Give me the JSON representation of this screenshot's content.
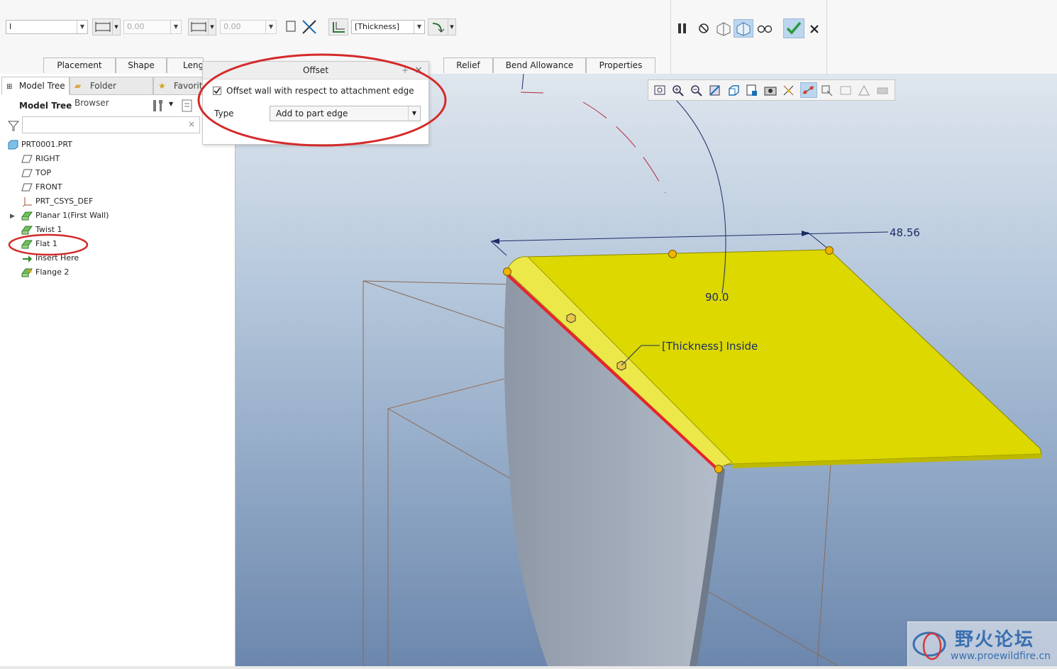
{
  "dashboard": {
    "type_value": "I",
    "length_value_1": "0.00",
    "length_value_2": "0.00",
    "thickness_value": "[Thickness]",
    "tabs": [
      "Placement",
      "Shape",
      "Leng",
      "Relief",
      "Bend Allowance",
      "Properties"
    ],
    "colors": {
      "ok_check": "#2a9a3a",
      "active_toggle": "#bcd6ee"
    }
  },
  "offset_panel": {
    "title": "Offset",
    "checkbox_label": "Offset wall with respect to attachment edge",
    "checkbox_checked": true,
    "type_label": "Type",
    "type_value": "Add to part edge",
    "close_glyph": "×",
    "pin_glyph": "+"
  },
  "navigator": {
    "tabs": [
      "Model Tree",
      "Folder Browser",
      "Favorit"
    ],
    "header": "Model Tree",
    "search_placeholder": "",
    "items": [
      {
        "label": "PRT0001.PRT",
        "icon": "part-icon"
      },
      {
        "label": "RIGHT",
        "icon": "datum-plane-icon"
      },
      {
        "label": "TOP",
        "icon": "datum-plane-icon"
      },
      {
        "label": "FRONT",
        "icon": "datum-plane-icon"
      },
      {
        "label": "PRT_CSYS_DEF",
        "icon": "csys-icon"
      },
      {
        "label": "Planar 1(First Wall)",
        "icon": "sheetmetal-wall-icon"
      },
      {
        "label": "Twist 1",
        "icon": "sheetmetal-wall-icon"
      },
      {
        "label": "Flat 1",
        "icon": "sheetmetal-wall-icon"
      },
      {
        "label": "Insert Here",
        "icon": "insert-arrow-icon"
      },
      {
        "label": "Flange 2",
        "icon": "flange-icon"
      }
    ],
    "highlight_color": "#d42a2a"
  },
  "viewport": {
    "dimension_length": "48.56",
    "dimension_angle": "90.0",
    "thickness_callout": "[Thickness] Inside",
    "colors": {
      "wall": "#dcd800",
      "edge": "#e8232b",
      "handle": "#f0b400"
    }
  },
  "watermark": {
    "text_cn": "野火论坛",
    "url": "www.proewildfire.cn"
  }
}
